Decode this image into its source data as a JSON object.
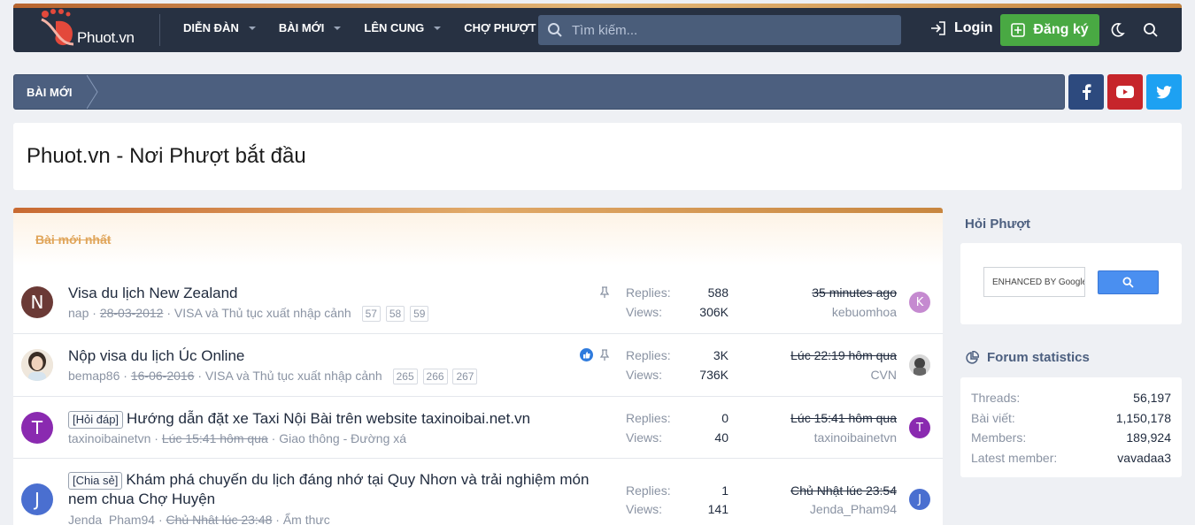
{
  "header": {
    "logo_text": "Phuot.vn",
    "nav": [
      {
        "label": "DIỄN ĐÀN"
      },
      {
        "label": "BÀI MỚI"
      },
      {
        "label": "LÊN CUNG"
      },
      {
        "label": "CHỢ PHƯỢT"
      }
    ],
    "search_placeholder": "Tìm kiếm...",
    "login_label": "Login",
    "register_label": "Đăng ký"
  },
  "breadcrumb": {
    "label": "BÀI MỚI"
  },
  "page_title": "Phuot.vn - Nơi Phượt bắt đầu",
  "block_title": "Bài mới nhất",
  "threads": [
    {
      "avatar_letter": "N",
      "avatar_color": "#6b3a36",
      "prefix": "",
      "title": "Visa du lịch New Zealand",
      "author": "nap",
      "date": "28-03-2012",
      "forum": "VISA và Thủ tục xuất nhập cảnh",
      "pages": [
        "57",
        "58",
        "59"
      ],
      "replies_label": "Replies:",
      "replies": "588",
      "views_label": "Views:",
      "views": "306K",
      "last_date": "35 minutes ago",
      "last_user": "kebuomhoa",
      "last_avatar_letter": "K",
      "last_avatar_color": "#c58ad0"
    },
    {
      "avatar_letter": "",
      "avatar_color": "#d9cfc2",
      "prefix": "",
      "title": "Nộp visa du lịch Úc Online",
      "author": "bemap86",
      "date": "16-06-2016",
      "forum": "VISA và Thủ tục xuất nhập cảnh",
      "pages": [
        "265",
        "266",
        "267"
      ],
      "replies_label": "Replies:",
      "replies": "3K",
      "views_label": "Views:",
      "views": "736K",
      "last_date": "Lúc 22:19 hôm qua",
      "last_user": "CVN",
      "last_avatar_letter": "",
      "last_avatar_color": "#555555"
    },
    {
      "avatar_letter": "T",
      "avatar_color": "#8a2ab0",
      "prefix": "[Hỏi đáp]",
      "title": "Hướng dẫn đặt xe Taxi Nội Bài trên website taxinoibai.net.vn",
      "author": "taxinoibainetvn",
      "date": "Lúc 15:41 hôm qua",
      "forum": "Giao thông - Đường xá",
      "pages": [],
      "replies_label": "Replies:",
      "replies": "0",
      "views_label": "Views:",
      "views": "40",
      "last_date": "Lúc 15:41 hôm qua",
      "last_user": "taxinoibainetvn",
      "last_avatar_letter": "T",
      "last_avatar_color": "#8a2ab0"
    },
    {
      "avatar_letter": "J",
      "avatar_color": "#4a6fd0",
      "prefix": "[Chia sẻ]",
      "title": "Khám phá chuyến du lịch đáng nhớ tại Quy Nhơn và trải nghiệm món nem chua Chợ Huyện",
      "author": "Jenda_Pham94",
      "date": "Chủ Nhật lúc 23:48",
      "forum": "Ẩm thực",
      "pages": [],
      "replies_label": "Replies:",
      "replies": "1",
      "views_label": "Views:",
      "views": "141",
      "last_date": "Chủ Nhật lúc 23:54",
      "last_user": "Jenda_Pham94",
      "last_avatar_letter": "J",
      "last_avatar_color": "#4a6fd0"
    }
  ],
  "sidebar": {
    "hoi_title": "Hỏi Phượt",
    "gsearch_placeholder": "ENHANCED BY Google",
    "stats_title": "Forum statistics",
    "stats": [
      {
        "label": "Threads:",
        "value": "56,197"
      },
      {
        "label": "Bài viết:",
        "value": "1,150,178"
      },
      {
        "label": "Members:",
        "value": "189,924"
      },
      {
        "label": "Latest member:",
        "value": "vavadaa3"
      }
    ]
  },
  "colors": {
    "header_bg": "#273142",
    "accent_gold": "#e0a968",
    "register_green": "#49a943",
    "crumb_bg": "#4c5f7f",
    "facebook": "#2d4a7e",
    "youtube": "#c6252b",
    "twitter": "#1da1f2"
  }
}
